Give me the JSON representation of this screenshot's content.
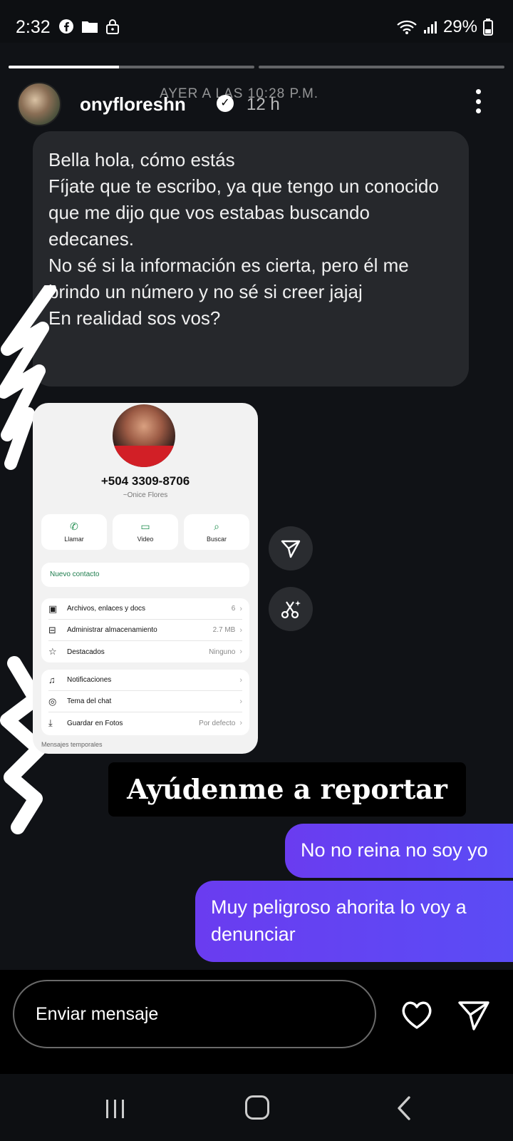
{
  "status_bar": {
    "time": "2:32",
    "battery": "29%",
    "icons": [
      "facebook-icon",
      "folder-icon",
      "lock-icon",
      "wifi-icon",
      "signal-icon",
      "battery-icon"
    ]
  },
  "story": {
    "progress": [
      0.45,
      0.0
    ],
    "username": "onyfloreshn",
    "time_ago": "12 h",
    "date_overlay": "AYER A LAS 10:28 P.M.",
    "message_lines": [
      "Bella hola, cómo estás",
      "Fíjate que te escribo, ya que tengo un conocido que me dijo que vos estabas buscando edecanes.",
      "No sé si la información es cierta, pero él me brindo un número y no sé si creer jajaj",
      "En realidad sos vos?"
    ],
    "contact_card": {
      "phone": "+504 3309-8706",
      "name": "~Onice Flores",
      "actions": [
        {
          "label": "Llamar",
          "icon": "phone-icon"
        },
        {
          "label": "Video",
          "icon": "video-icon"
        },
        {
          "label": "Buscar",
          "icon": "search-icon"
        }
      ],
      "new_contact": "Nuevo contacto",
      "rows_group1": [
        {
          "icon": "image-icon",
          "label": "Archivos, enlaces y docs",
          "value": "6"
        },
        {
          "icon": "storage-icon",
          "label": "Administrar almacenamiento",
          "value": "2.7 MB"
        },
        {
          "icon": "star-icon",
          "label": "Destacados",
          "value": "Ninguno"
        }
      ],
      "rows_group2": [
        {
          "icon": "bell-icon",
          "label": "Notificaciones",
          "value": ""
        },
        {
          "icon": "palette-icon",
          "label": "Tema del chat",
          "value": ""
        },
        {
          "icon": "download-icon",
          "label": "Guardar en Fotos",
          "value": "Por defecto"
        }
      ],
      "cut_row": "Mensajes temporales"
    },
    "sticker": "Ayúdenme a reportar",
    "reply_1": "No no reina no soy yo",
    "reply_2": "Muy peligroso ahorita lo voy a denunciar"
  },
  "input": {
    "placeholder": "Enviar mensaje"
  },
  "colors": {
    "accent_gradient_start": "#6a3cf0",
    "accent_gradient_end": "#5b4cf5",
    "bubble_in": "#26282c",
    "background": "#101216"
  }
}
